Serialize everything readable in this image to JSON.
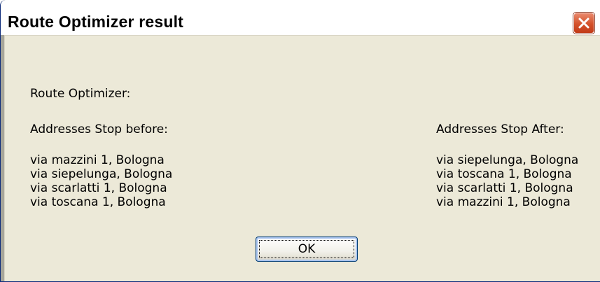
{
  "window": {
    "title": "Route Optimizer result",
    "close_icon": "close-icon"
  },
  "dialog": {
    "heading": "Route Optimizer:",
    "before": {
      "label": "Addresses Stop before:",
      "addresses": [
        "via mazzini 1, Bologna",
        "via siepelunga, Bologna",
        "via scarlatti 1, Bologna",
        "via toscana 1, Bologna"
      ]
    },
    "after": {
      "label": "Addresses Stop After:",
      "addresses": [
        "via siepelunga, Bologna",
        "via toscana 1, Bologna",
        "via scarlatti 1, Bologna",
        "via mazzini 1, Bologna"
      ]
    },
    "ok_label": "OK"
  },
  "colors": {
    "title_bar": "#ffffff",
    "dialog_background": "#ece9d8",
    "close_button": "#d4512a",
    "button_border": "#003c74"
  }
}
